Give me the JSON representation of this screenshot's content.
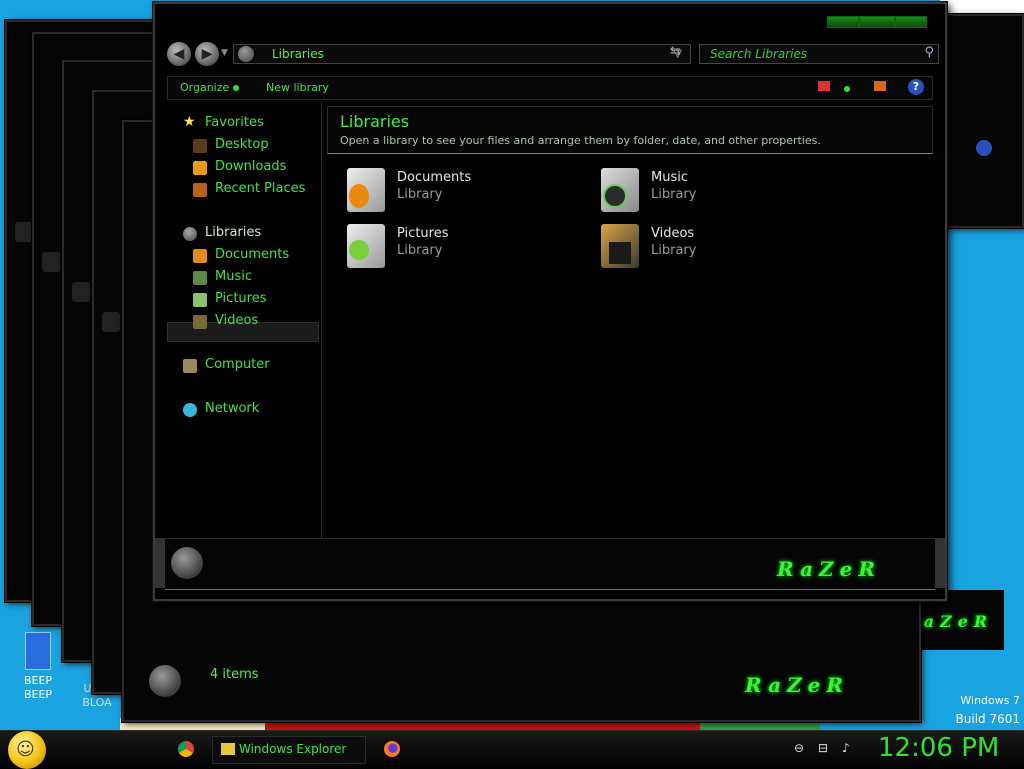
{
  "explorer": {
    "address_label": "Libraries",
    "search_placeholder": "Search Libraries",
    "toolbar": {
      "organize": "Organize",
      "new_library": "New library"
    },
    "nav": {
      "favorites": "Favorites",
      "desktop": "Desktop",
      "downloads": "Downloads",
      "recent_places": "Recent Places",
      "libraries": "Libraries",
      "documents": "Documents",
      "music": "Music",
      "pictures": "Pictures",
      "videos": "Videos",
      "computer": "Computer",
      "network": "Network"
    },
    "content": {
      "title": "Libraries",
      "description": "Open a library to see your files and arrange them by folder, date, and other properties.",
      "items": [
        {
          "name": "Documents",
          "type": "Library"
        },
        {
          "name": "Music",
          "type": "Library"
        },
        {
          "name": "Pictures",
          "type": "Library"
        },
        {
          "name": "Videos",
          "type": "Library"
        }
      ]
    },
    "brand": "RaZeR"
  },
  "background_window": {
    "status": "4 items",
    "brand": "RaZeR"
  },
  "desktop": {
    "icon_beep": "BEEP\nBEEP",
    "icon_ultra": "ULTR\nBLOA",
    "os_name": "Windows 7",
    "build": "Build 7601"
  },
  "taskbar": {
    "explorer_button": "Windows Explorer",
    "clock": "12:06 PM"
  },
  "colors": {
    "accent": "#3cf03c",
    "window_bg": "#000000",
    "desktop_bg": "#19a3e0"
  }
}
